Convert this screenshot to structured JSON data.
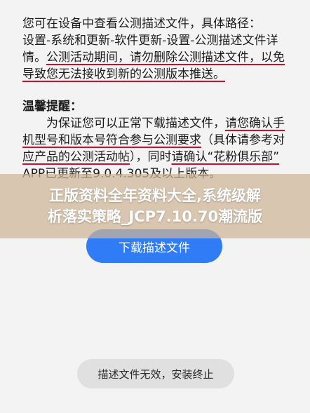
{
  "info": {
    "line1": "您可在设备中查看公测描述文件，具体路径：",
    "line2": "设置-系统和更新-软件更新-设置-公测描述文件详",
    "line3_pre": "情。",
    "line3_u": "公测活动期间，请勿删除公测描述文件，以免",
    "line4_u": "导致您无法接收到新的公测版本推送。"
  },
  "reminder": {
    "heading": "温馨提醒：",
    "line1_pre": "为保证您可以正常下载描述文件，",
    "line1_u": "请您确认手",
    "line2_u": "机型号和版本号符合参与公测要求",
    "line2_post": "（具体请参考对",
    "line3_u": "应产品的公测活动帖",
    "line3_mid": "），同时",
    "line3_u2": "请确认“花粉俱乐部”",
    "line4": "APP已更新至9.0.4.305及以上版本。"
  },
  "banner": {
    "line1": "正版资料全年资料大全,系统级解",
    "line2": "析落实策略_JCP7.10.70潮流版"
  },
  "download_button_label": "下载描述文件",
  "toast_message": "描述文件无效，安装终止"
}
